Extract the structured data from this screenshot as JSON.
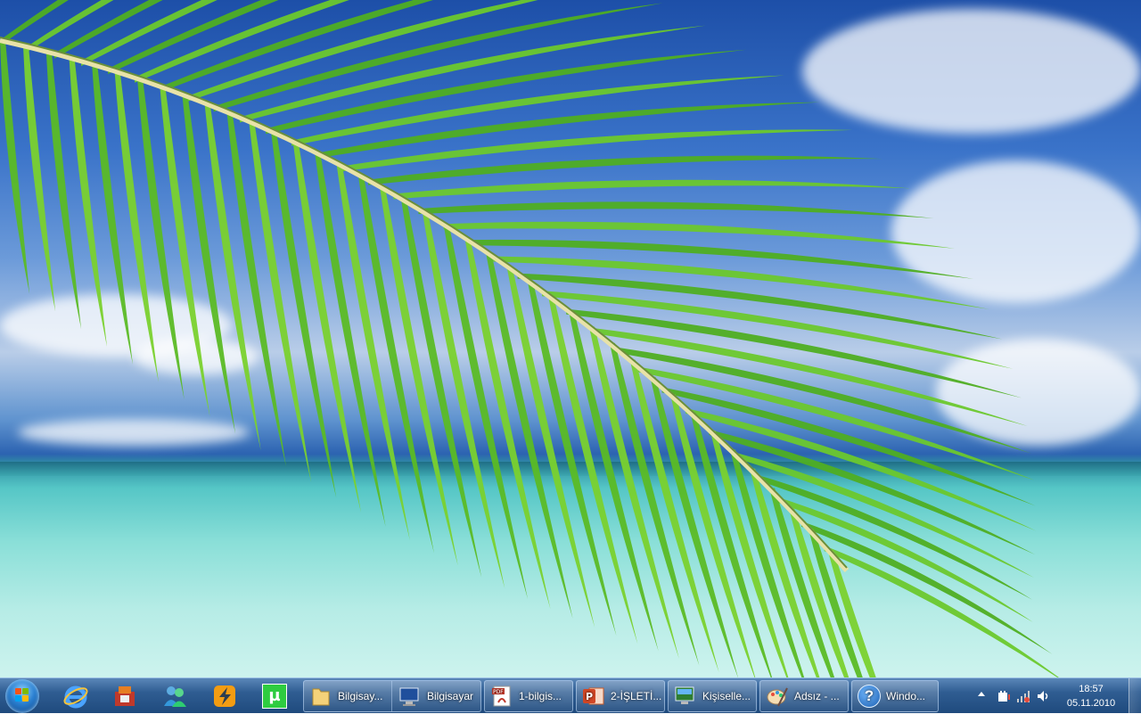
{
  "taskbar": {
    "pinned": [
      {
        "name": "internet-explorer-icon"
      },
      {
        "name": "toolbox-app-icon"
      },
      {
        "name": "messenger-icon"
      },
      {
        "name": "winamp-icon"
      },
      {
        "name": "utorrent-icon",
        "glyph": "µ"
      }
    ],
    "tasks": [
      {
        "label": "Bilgisay...",
        "icon": "folder-icon"
      },
      {
        "label": "Bilgisayar",
        "icon": "computer-icon"
      },
      {
        "label": "1-bilgis...",
        "icon": "pdf-icon",
        "badge": "PDF"
      },
      {
        "label": "2-İŞLETİ...",
        "icon": "powerpoint-icon"
      },
      {
        "label": "Kişiselle...",
        "icon": "personalize-icon"
      },
      {
        "label": "Adsız - ...",
        "icon": "paint-icon"
      },
      {
        "label": "Windo...",
        "icon": "help-icon",
        "glyph": "?"
      }
    ],
    "tray": {
      "time": "18:57",
      "date": "05.11.2010"
    }
  },
  "colors": {
    "taskbar": "#2f5d92",
    "leaf": "#5fbf2a",
    "sea": "#8adfd8"
  }
}
